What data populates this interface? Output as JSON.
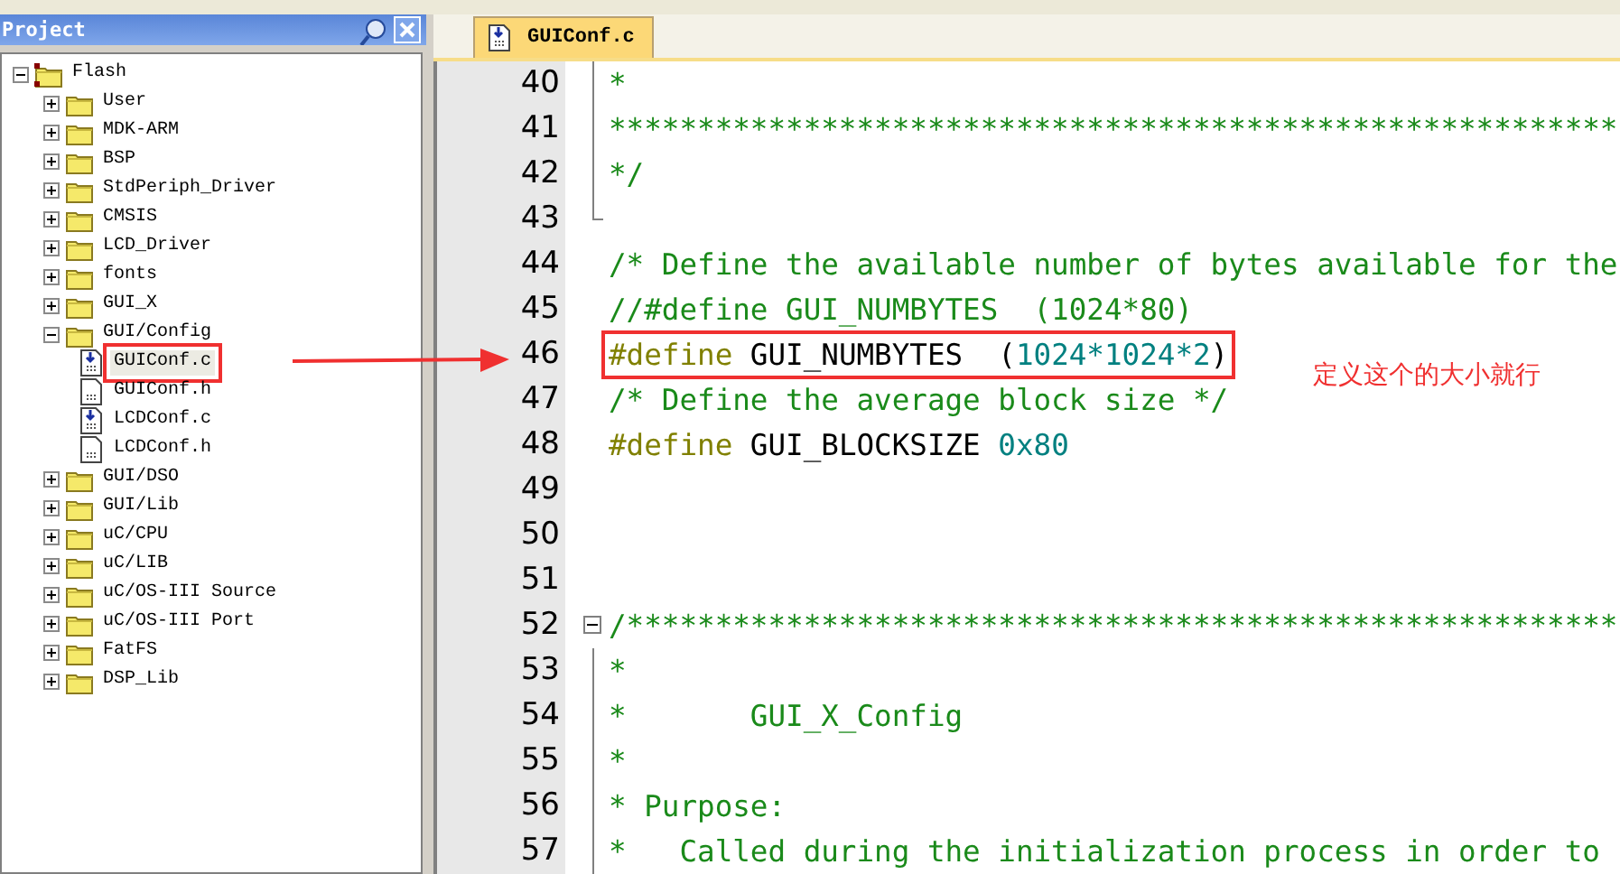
{
  "project_panel": {
    "title": "Project",
    "tree": [
      {
        "label": "Flash",
        "kind": "root",
        "expanded": true,
        "children": [
          {
            "label": "User",
            "kind": "folder",
            "expanded": false
          },
          {
            "label": "MDK-ARM",
            "kind": "folder",
            "expanded": false
          },
          {
            "label": "BSP",
            "kind": "folder",
            "expanded": false
          },
          {
            "label": "StdPeriph_Driver",
            "kind": "folder",
            "expanded": false
          },
          {
            "label": "CMSIS",
            "kind": "folder",
            "expanded": false
          },
          {
            "label": "LCD_Driver",
            "kind": "folder",
            "expanded": false
          },
          {
            "label": "fonts",
            "kind": "folder",
            "expanded": false
          },
          {
            "label": "GUI_X",
            "kind": "folder",
            "expanded": false
          },
          {
            "label": "GUI/Config",
            "kind": "folder",
            "expanded": true,
            "children": [
              {
                "label": "GUIConf.c",
                "kind": "source",
                "selected": true,
                "annotated": true
              },
              {
                "label": "GUIConf.h",
                "kind": "header",
                "selected": false,
                "annotated": false
              },
              {
                "label": "LCDConf.c",
                "kind": "source",
                "selected": false,
                "annotated": false
              },
              {
                "label": "LCDConf.h",
                "kind": "header",
                "selected": false,
                "annotated": false
              }
            ]
          },
          {
            "label": "GUI/DSO",
            "kind": "folder",
            "expanded": false
          },
          {
            "label": "GUI/Lib",
            "kind": "folder",
            "expanded": false
          },
          {
            "label": "uC/CPU",
            "kind": "folder",
            "expanded": false
          },
          {
            "label": "uC/LIB",
            "kind": "folder",
            "expanded": false
          },
          {
            "label": "uC/OS-III Source",
            "kind": "folder",
            "expanded": false
          },
          {
            "label": "uC/OS-III Port",
            "kind": "folder",
            "expanded": false
          },
          {
            "label": "FatFS",
            "kind": "folder",
            "expanded": false
          },
          {
            "label": "DSP_Lib",
            "kind": "folder",
            "expanded": false
          }
        ]
      }
    ]
  },
  "editor": {
    "tab": {
      "label": "GUIConf.c",
      "selected": true
    },
    "lines": [
      {
        "number": "40",
        "annotated": false,
        "segments": [
          {
            "kind": "comment",
            "text": "*"
          }
        ]
      },
      {
        "number": "41",
        "annotated": false,
        "segments": [
          {
            "kind": "comment",
            "text": "*********************************************************"
          }
        ]
      },
      {
        "number": "42",
        "annotated": false,
        "segments": [
          {
            "kind": "comment",
            "text": "*/"
          }
        ]
      },
      {
        "number": "43",
        "annotated": false
      },
      {
        "number": "44",
        "annotated": false,
        "segments": [
          {
            "kind": "comment",
            "text": "/* Define the available number of bytes available for the"
          }
        ]
      },
      {
        "number": "45",
        "annotated": false,
        "segments": [
          {
            "kind": "comment",
            "text": "//#define GUI_NUMBYTES  (1024*80)"
          }
        ]
      },
      {
        "number": "46",
        "annotated": true,
        "segments": [
          {
            "kind": "directive",
            "text": "#define"
          },
          {
            "kind": "plain",
            "text": " GUI_NUMBYTES  ("
          },
          {
            "kind": "number",
            "text": "1024*1024*2"
          },
          {
            "kind": "plain",
            "text": ")"
          }
        ]
      },
      {
        "number": "47",
        "annotated": false,
        "segments": [
          {
            "kind": "comment",
            "text": "/* Define the average block size */"
          }
        ]
      },
      {
        "number": "48",
        "annotated": false,
        "segments": [
          {
            "kind": "directive",
            "text": "#define"
          },
          {
            "kind": "plain",
            "text": " GUI_BLOCKSIZE "
          },
          {
            "kind": "number",
            "text": "0x80"
          }
        ]
      },
      {
        "number": "49",
        "annotated": false
      },
      {
        "number": "50",
        "annotated": false
      },
      {
        "number": "51",
        "annotated": false
      },
      {
        "number": "52",
        "annotated": false,
        "fold": true,
        "segments": [
          {
            "kind": "comment",
            "text": "/********************************************************"
          }
        ]
      },
      {
        "number": "53",
        "annotated": false,
        "segments": [
          {
            "kind": "comment",
            "text": "*"
          }
        ]
      },
      {
        "number": "54",
        "annotated": false,
        "segments": [
          {
            "kind": "comment",
            "text": "*       GUI_X_Config"
          }
        ]
      },
      {
        "number": "55",
        "annotated": false,
        "segments": [
          {
            "kind": "comment",
            "text": "*"
          }
        ]
      },
      {
        "number": "56",
        "annotated": false,
        "segments": [
          {
            "kind": "comment",
            "text": "* Purpose:"
          }
        ]
      },
      {
        "number": "57",
        "annotated": false,
        "segments": [
          {
            "kind": "comment",
            "text": "*   Called during the initialization process in order to"
          }
        ]
      }
    ]
  },
  "annotation": {
    "text": "定义这个的大小就行"
  }
}
